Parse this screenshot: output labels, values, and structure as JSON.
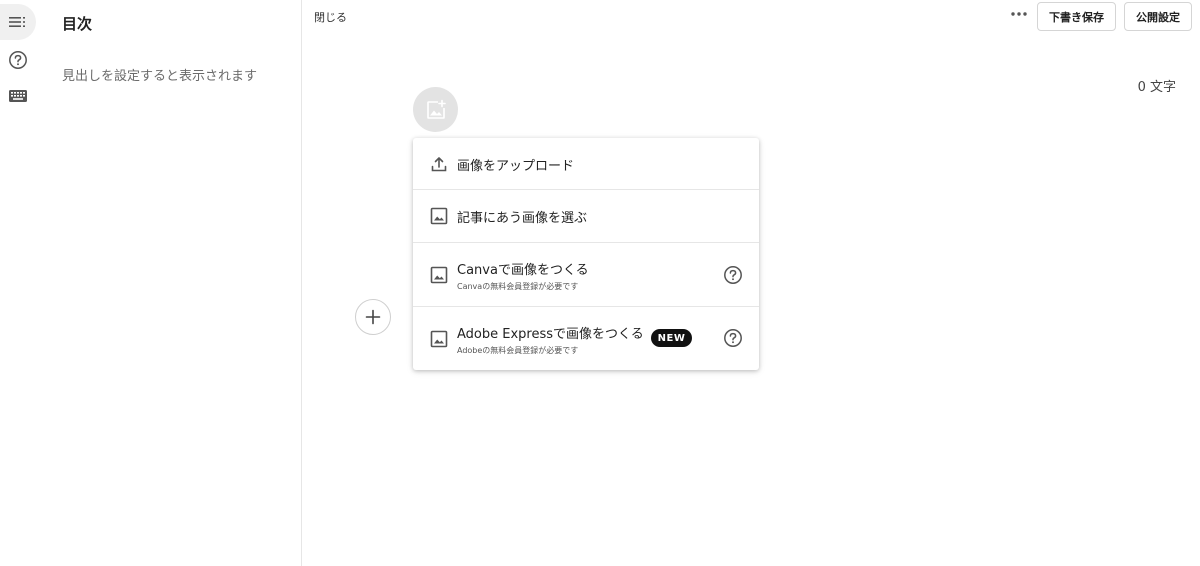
{
  "rail": {
    "items": [
      {
        "icon": "toc-list-icon",
        "active": true
      },
      {
        "icon": "help-circle-icon",
        "active": false
      },
      {
        "icon": "keyboard-icon",
        "active": false
      }
    ]
  },
  "toc": {
    "title": "目次",
    "empty_message": "見出しを設定すると表示されます"
  },
  "header": {
    "close_label": "閉じる",
    "more_icon": "more-horizontal-icon",
    "draft_label": "下書き保存",
    "publish_label": "公開設定"
  },
  "editor": {
    "char_count": "0 文字",
    "add_image_icon": "add-image-icon",
    "add_block_icon": "plus-icon"
  },
  "image_menu": {
    "items": [
      {
        "label": "画像をアップロード",
        "icon": "upload-icon"
      },
      {
        "label": "記事にあう画像を選ぶ",
        "icon": "image-icon"
      },
      {
        "label": "Canvaで画像をつくる",
        "sub": "Canvaの無料会員登録が必要です",
        "icon": "image-icon",
        "help_icon": "help-circle-icon"
      },
      {
        "label": "Adobe Expressで画像をつくる",
        "sub": "Adobeの無料会員登録が必要です",
        "badge": "NEW",
        "icon": "image-icon",
        "help_icon": "help-circle-icon"
      }
    ]
  },
  "colors": {
    "text": "#222222",
    "muted": "#6b6b6b",
    "border": "#e6e6e6",
    "badge_bg": "#111111",
    "image_circle": "#e3e3e3"
  }
}
